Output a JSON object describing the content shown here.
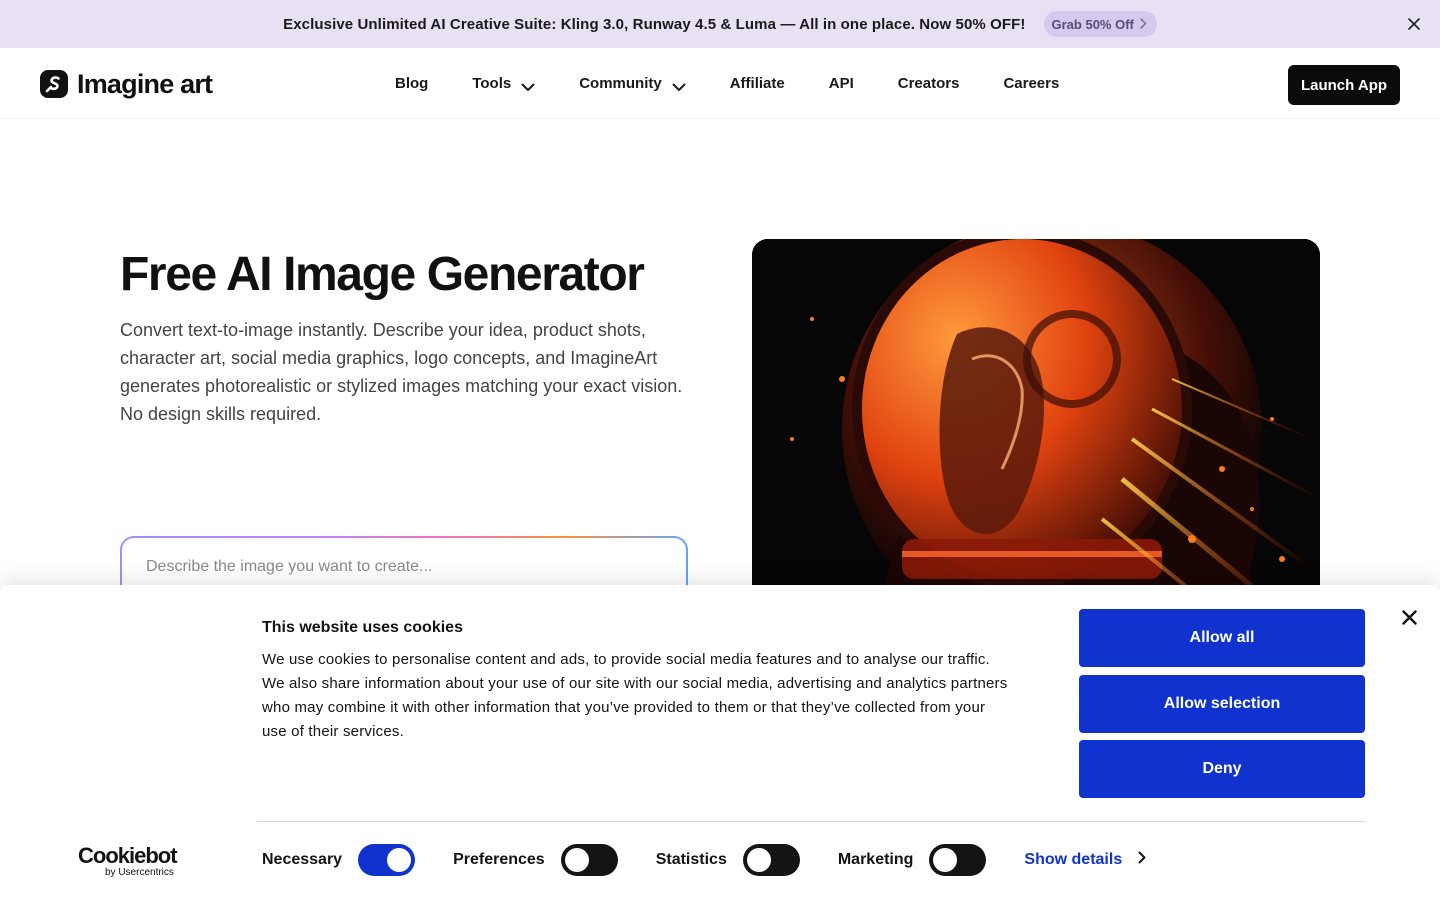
{
  "promo": {
    "text": "Exclusive Unlimited AI Creative Suite: Kling 3.0, Runway 4.5 & Luma — All in one place.  Now 50% OFF!",
    "cta": "Grab 50% Off",
    "close_icon": "close-icon"
  },
  "header": {
    "logo_text": "Imagine art",
    "nav": [
      {
        "label": "Blog"
      },
      {
        "label": "Tools"
      },
      {
        "label": "Community"
      },
      {
        "label": "Affiliate"
      },
      {
        "label": "API"
      },
      {
        "label": "Creators"
      },
      {
        "label": "Careers"
      }
    ],
    "launch": "Launch App"
  },
  "hero": {
    "title": "Free AI Image Generator",
    "description": "Convert text-to-image instantly. Describe your idea, product shots, character art, social media graphics, logo concepts, and ImagineArt generates photorealistic or stylized images matching your exact vision. No design skills required.",
    "prompt_placeholder": "Describe the image you want to create..."
  },
  "cookie": {
    "title": "This website uses cookies",
    "text": "We use cookies to personalise content and ads, to provide social media features and to analyse our traffic. We also share information about your use of our site with our social media, advertising and analytics partners who may combine it with other information that you’ve provided to them or that they’ve collected from your use of their services.",
    "allow_all": "Allow all",
    "allow_selection": "Allow selection",
    "deny": "Deny",
    "brand": "Cookiebot",
    "brand_sub": "by Usercentrics",
    "toggles": [
      {
        "label": "Necessary",
        "on": true
      },
      {
        "label": "Preferences",
        "on": false
      },
      {
        "label": "Statistics",
        "on": false
      },
      {
        "label": "Marketing",
        "on": false
      }
    ],
    "show_details": "Show details"
  },
  "colors": {
    "promo_bg": "#e7e1f3",
    "cookie_blue": "#1032cf",
    "black": "#0b0b0b"
  }
}
